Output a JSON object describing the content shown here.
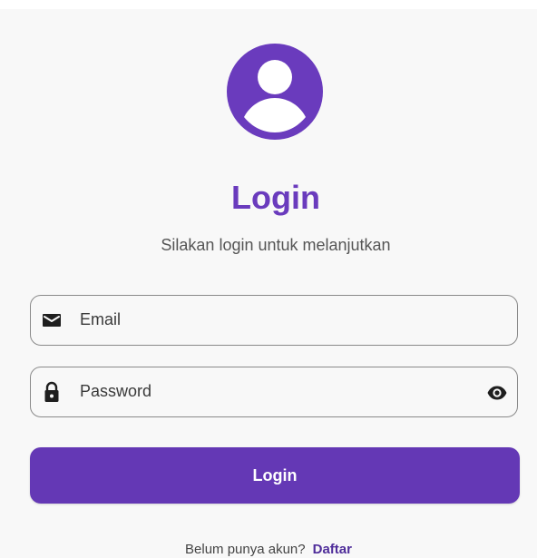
{
  "colors": {
    "accent": "#6438b5",
    "title": "#6a3bbd",
    "panel_background": "#f8f8f8"
  },
  "header": {
    "avatar_icon": "account-circle-icon",
    "title": "Login",
    "subtitle": "Silakan login untuk melanjutkan"
  },
  "form": {
    "email": {
      "icon": "mail-icon",
      "placeholder": "Email",
      "value": ""
    },
    "password": {
      "icon": "lock-icon",
      "placeholder": "Password",
      "value": "",
      "toggle_icon": "eye-icon"
    },
    "submit_label": "Login"
  },
  "footer": {
    "prompt": "Belum punya akun?",
    "link_label": "Daftar"
  }
}
